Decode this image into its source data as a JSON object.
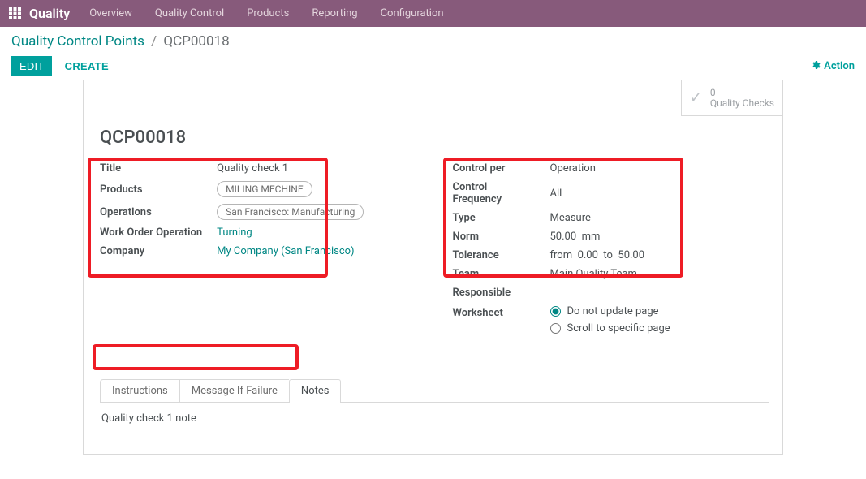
{
  "nav": {
    "app": "Quality",
    "items": [
      "Overview",
      "Quality Control",
      "Products",
      "Reporting",
      "Configuration"
    ]
  },
  "breadcrumb": {
    "root": "Quality Control Points",
    "current": "QCP00018"
  },
  "buttons": {
    "edit": "EDIT",
    "create": "CREATE",
    "action": "Action"
  },
  "stat": {
    "count": "0",
    "label": "Quality Checks"
  },
  "record": {
    "title": "QCP00018"
  },
  "left": {
    "title_label": "Title",
    "title_value": "Quality check 1",
    "products_label": "Products",
    "products_tag": "MILING MECHINE",
    "operations_label": "Operations",
    "operations_tag": "San Francisco: Manufacturing",
    "woo_label": "Work Order Operation",
    "woo_value": "Turning",
    "company_label": "Company",
    "company_value": "My Company (San Francisco)"
  },
  "right": {
    "control_per_label": "Control per",
    "control_per_value": "Operation",
    "freq_label": "Control Frequency",
    "freq_value": "All",
    "type_label": "Type",
    "type_value": "Measure",
    "norm_label": "Norm",
    "norm_value": "50.00",
    "norm_unit": "mm",
    "tol_label": "Tolerance",
    "tol_from": "from",
    "tol_from_v": "0.00",
    "tol_to": "to",
    "tol_to_v": "50.00",
    "team_label": "Team",
    "team_value": "Main Quality Team",
    "resp_label": "Responsible",
    "ws_label": "Worksheet",
    "ws_opt1": "Do not update page",
    "ws_opt2": "Scroll to specific page"
  },
  "tabs": {
    "instructions": "Instructions",
    "msgfail": "Message If Failure",
    "notes": "Notes"
  },
  "note_body": "Quality check 1 note"
}
